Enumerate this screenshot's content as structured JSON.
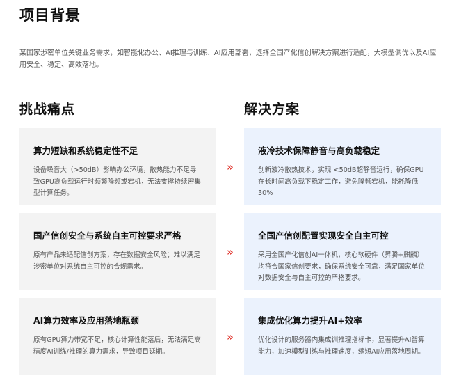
{
  "background": {
    "title": "项目背景",
    "description": "某国家涉密单位关键业务需求，如智能化办公、AI推理与训练、AI应用部署，选择全国产化信创解决方案进行适配，大模型调优以及AI应用安全、稳定、高效落地。"
  },
  "columns": {
    "challenges_title": "挑战痛点",
    "solutions_title": "解决方案"
  },
  "arrow_glyph": "»",
  "accent_color": "#e0332c",
  "rows": [
    {
      "challenge": {
        "title": "算力短缺和系统稳定性不足",
        "desc": "设备噪音大（>50dB）影响办公环境，散热能力不足导致GPU高负载运行时频繁降频或宕机，无法支撑持续密集型计算任务。"
      },
      "solution": {
        "title": "液冷技术保障静音与高负载稳定",
        "desc": "创新液冷散热技术，实现 <50dB超静音运行，确保GPU在长时间高负载下稳定工作，避免降频宕机，能耗降低30%"
      }
    },
    {
      "challenge": {
        "title": "国产信创安全与系统自主可控要求严格",
        "desc": "原有产品未适配信创方案，存在数据安全风险；难以满足涉密单位对系统自主可控的合规需求。"
      },
      "solution": {
        "title": "全国产信创配置实现安全自主可控",
        "desc": "采用全国产化信创AI一体机，核心软硬件（昇腾+麒麟）均符合国家信创要求，确保系统安全可靠，满足国家单位对数据安全与自主可控的严格要求。"
      }
    },
    {
      "challenge": {
        "title": "AI算力效率及应用落地瓶颈",
        "desc": "原有GPU算力带宽不足，核心计算性能落后，无法满足高精度AI训练/推理的算力需求，导致项目延期。"
      },
      "solution": {
        "title": "集成优化算力提升AI+效率",
        "desc": "优化设计的服务器内集成训推理指标卡，显著提升AI智算能力，加速模型训练与推理速度，缩短AI应用落地周期。"
      }
    }
  ]
}
